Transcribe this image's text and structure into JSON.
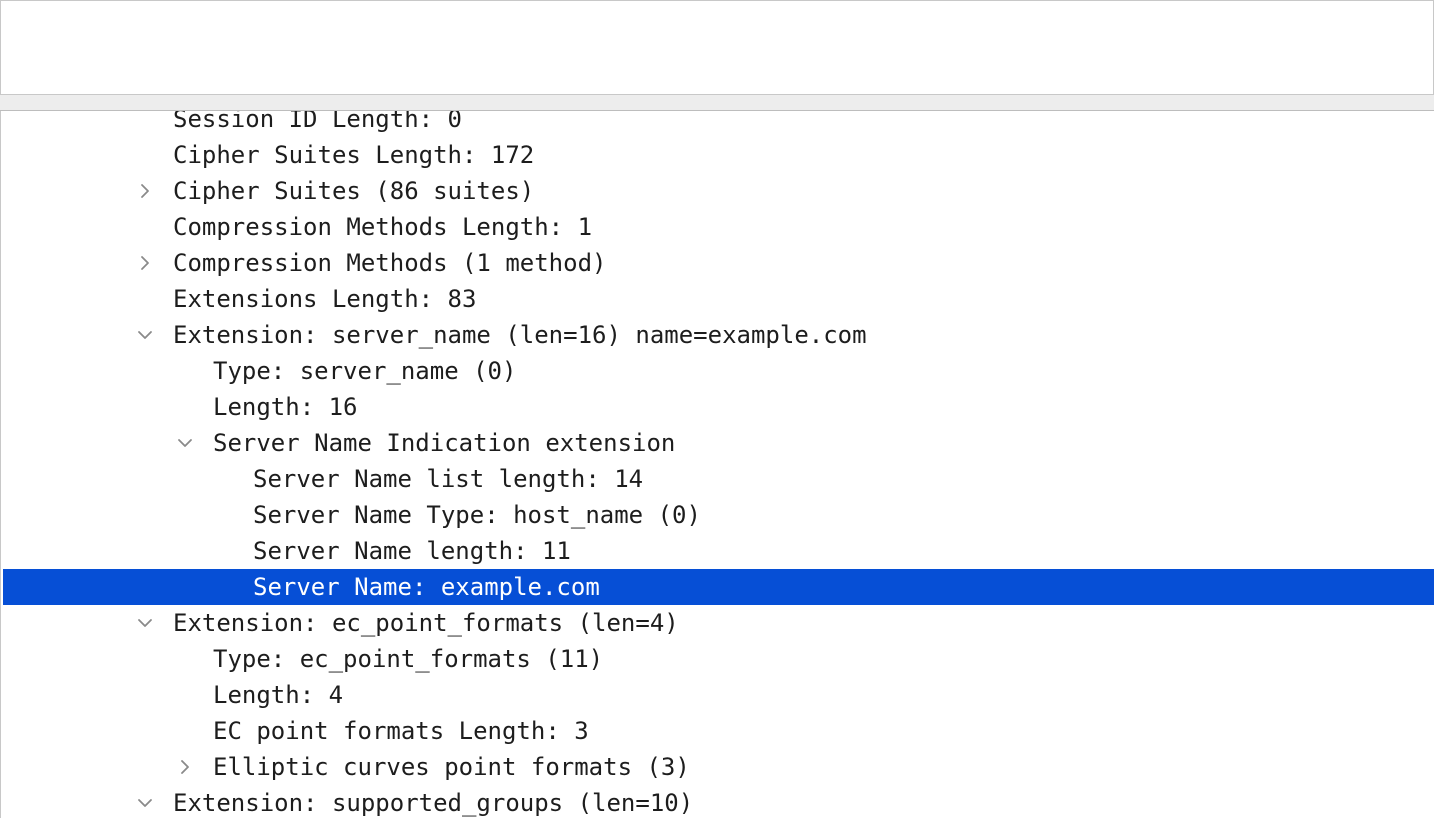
{
  "tree": {
    "rows": [
      {
        "text": "Session ID Length: 0",
        "level": 0,
        "expander": "none",
        "selected": false
      },
      {
        "text": "Cipher Suites Length: 172",
        "level": 0,
        "expander": "none",
        "selected": false
      },
      {
        "text": "Cipher Suites (86 suites)",
        "level": 0,
        "expander": "collapsed",
        "selected": false
      },
      {
        "text": "Compression Methods Length: 1",
        "level": 0,
        "expander": "none",
        "selected": false
      },
      {
        "text": "Compression Methods (1 method)",
        "level": 0,
        "expander": "collapsed",
        "selected": false
      },
      {
        "text": "Extensions Length: 83",
        "level": 0,
        "expander": "none",
        "selected": false
      },
      {
        "text": "Extension: server_name (len=16) name=example.com",
        "level": 0,
        "expander": "expanded",
        "selected": false
      },
      {
        "text": "Type: server_name (0)",
        "level": 1,
        "expander": "none",
        "selected": false
      },
      {
        "text": "Length: 16",
        "level": 1,
        "expander": "none",
        "selected": false
      },
      {
        "text": "Server Name Indication extension",
        "level": 1,
        "expander": "expanded",
        "selected": false
      },
      {
        "text": "Server Name list length: 14",
        "level": 2,
        "expander": "none",
        "selected": false
      },
      {
        "text": "Server Name Type: host_name (0)",
        "level": 2,
        "expander": "none",
        "selected": false
      },
      {
        "text": "Server Name length: 11",
        "level": 2,
        "expander": "none",
        "selected": false
      },
      {
        "text": "Server Name: example.com",
        "level": 2,
        "expander": "none",
        "selected": true
      },
      {
        "text": "Extension: ec_point_formats (len=4)",
        "level": 0,
        "expander": "expanded",
        "selected": false
      },
      {
        "text": "Type: ec_point_formats (11)",
        "level": 1,
        "expander": "none",
        "selected": false
      },
      {
        "text": "Length: 4",
        "level": 1,
        "expander": "none",
        "selected": false
      },
      {
        "text": "EC point formats Length: 3",
        "level": 1,
        "expander": "none",
        "selected": false
      },
      {
        "text": "Elliptic curves point formats (3)",
        "level": 1,
        "expander": "collapsed",
        "selected": false
      },
      {
        "text": "Extension: supported_groups (len=10)",
        "level": 0,
        "expander": "expanded",
        "selected": false
      }
    ]
  },
  "colors": {
    "selection": "#064fd6",
    "text": "#1d1d1d",
    "selected_text": "#ffffff",
    "arrow": "#8a8a8a"
  },
  "icons": {
    "collapsed": "chevron-right-icon",
    "expanded": "chevron-down-icon"
  }
}
